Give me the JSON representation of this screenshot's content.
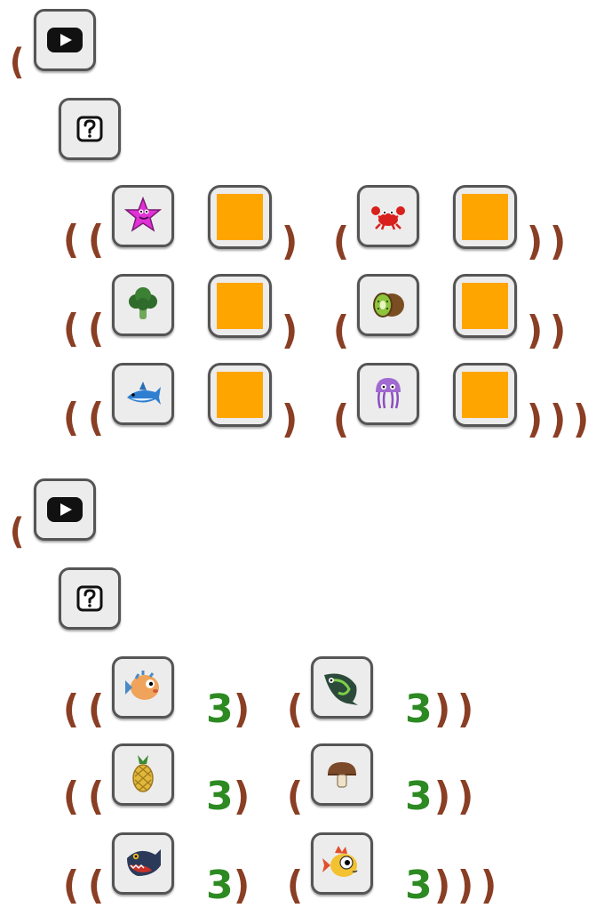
{
  "colors": {
    "paren": "#8a3e24",
    "number": "#2d8a22",
    "swatch": "#ffa500",
    "tile_bg": "#ececec",
    "tile_border": "#555555"
  },
  "icons": {
    "play": "play-icon",
    "question": "question-icon",
    "section1": [
      "starfish-icon",
      "crab-icon",
      "broccoli-icon",
      "kiwi-icon",
      "shark-icon",
      "jellyfish-icon"
    ],
    "section2": [
      "pufferfish-icon",
      "green-fish-icon",
      "pineapple-icon",
      "mushroom-icon",
      "piranha-icon",
      "yellow-fish-icon"
    ]
  },
  "symbols": {
    "open": "(",
    "close": ")"
  },
  "section2": {
    "counts": [
      "3",
      "3",
      "3",
      "3",
      "3",
      "3"
    ]
  }
}
